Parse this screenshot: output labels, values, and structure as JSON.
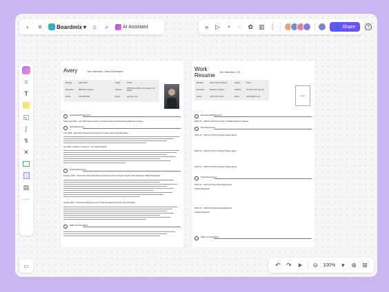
{
  "toolbar": {
    "app_name": "Boardmix",
    "ai_label": "AI Assistant",
    "share_label": "Share",
    "help_label": "?"
  },
  "zoom": {
    "value": "100%"
  },
  "page1": {
    "name": "Avery",
    "subtitle": "Job Intention: Java Developer",
    "info": [
      {
        "label": "Birthday",
        "value": "1997.05.15"
      },
      {
        "label": "Height",
        "value": "175cm"
      },
      {
        "label": "Education",
        "value": "Bachelor's Degree"
      },
      {
        "label": "Address",
        "value": "3250 Sunset Blvd, Los Angeles, CA 90028"
      },
      {
        "label": "Phone",
        "value": "1234 567 890"
      },
      {
        "label": "Email",
        "value": "Avery@...com"
      }
    ],
    "education_title": "Educational Background",
    "education_row": "September 2015 – July 2019     Yale University / Computer Science and Technology     Bachelor's Degree",
    "work_title": "Work Experience",
    "work_rows": [
      "June 2019 – May 2020     Certain Internet Finance Company     Senior Java Developer",
      "July 2020 – Present     IT Group Co., Ltd.     Java Developer"
    ],
    "project_title": "Project Experience",
    "project_rows": [
      "February 2023 – December 2023     Optimization of High Concurrency Payment System     Core Developer / Backend Engineer",
      "January 2020 – November 2020     E-commerce Order Management System     Java Developer"
    ],
    "skills_title": "Skills and Specialties"
  },
  "page2": {
    "name": "Work Resume",
    "subtitle": "Job Intention: XX",
    "info": [
      {
        "label": "Birthday",
        "value": "XXXX Year XX Month"
      },
      {
        "label": "Height",
        "value": "XXcm"
      },
      {
        "label": "Education",
        "value": "Bachelor's Degree"
      },
      {
        "label": "Address",
        "value": "XX Street, XX City, XX"
      },
      {
        "label": "Phone",
        "value": "XXXX XXX XXXX"
      },
      {
        "label": "Email",
        "value": "XXXXX@XX.com"
      }
    ],
    "photo_label": "photo",
    "education_title": "Educational Background",
    "education_row": "20XX.XX – 20XX.XX     XXXX University / XX Major     Bachelor's Degree",
    "work_title": "Work Experience",
    "work_rows": [
      "20XX.XX – 20XX.XX     XXXX Company     Position Name",
      "20XX.XX – 20XX.XX     XXXX Company     Position Name",
      "20XX.XX – 20XX.XX     XXXX Company     Position Name"
    ],
    "project_title": "Project Experience",
    "project_rows": [
      "20XX.XX – 20XX.XX     Project Name     Role Name",
      "20XX.XX – 20XX.XX     Project Name     Role Name"
    ],
    "project_desc": "Project Description",
    "skills_title": "Skills and Specialties"
  }
}
